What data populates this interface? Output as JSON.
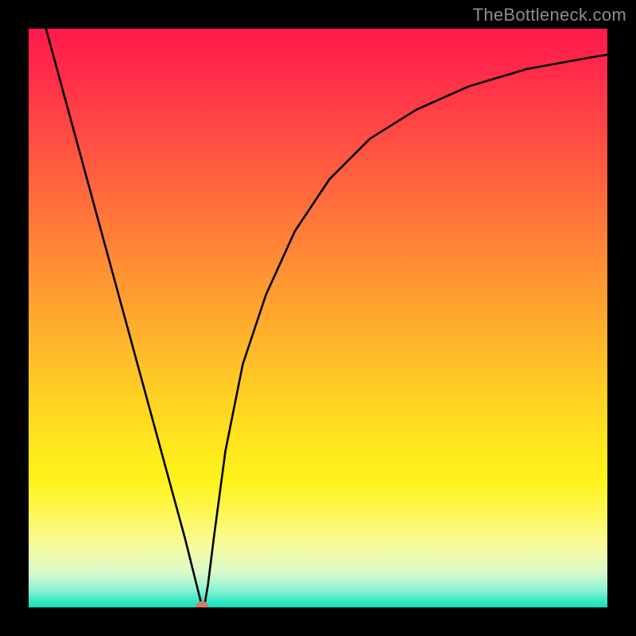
{
  "watermark": "TheBottleneck.com",
  "chart_data": {
    "type": "line",
    "title": "",
    "xlabel": "",
    "ylabel": "",
    "xlim": [
      0,
      100
    ],
    "ylim": [
      0,
      100
    ],
    "grid": false,
    "series": [
      {
        "name": "bottleneck-curve",
        "x": [
          3,
          6,
          9,
          12,
          15,
          18,
          21,
          24,
          27,
          28.5,
          29.5,
          30,
          30.5,
          31,
          32,
          34,
          37,
          41,
          46,
          52,
          59,
          67,
          76,
          86,
          97,
          100
        ],
        "y": [
          100,
          89,
          78,
          67,
          56,
          45,
          34,
          23,
          12,
          6,
          2,
          0,
          1,
          4,
          12,
          27,
          42,
          54,
          65,
          74,
          81,
          86,
          90,
          93,
          95,
          95.5
        ],
        "color": "#000000"
      }
    ],
    "marker": {
      "name": "bottleneck-point",
      "x": 30,
      "y": 0,
      "color": "#d47a6a",
      "radius": 1.1
    }
  }
}
